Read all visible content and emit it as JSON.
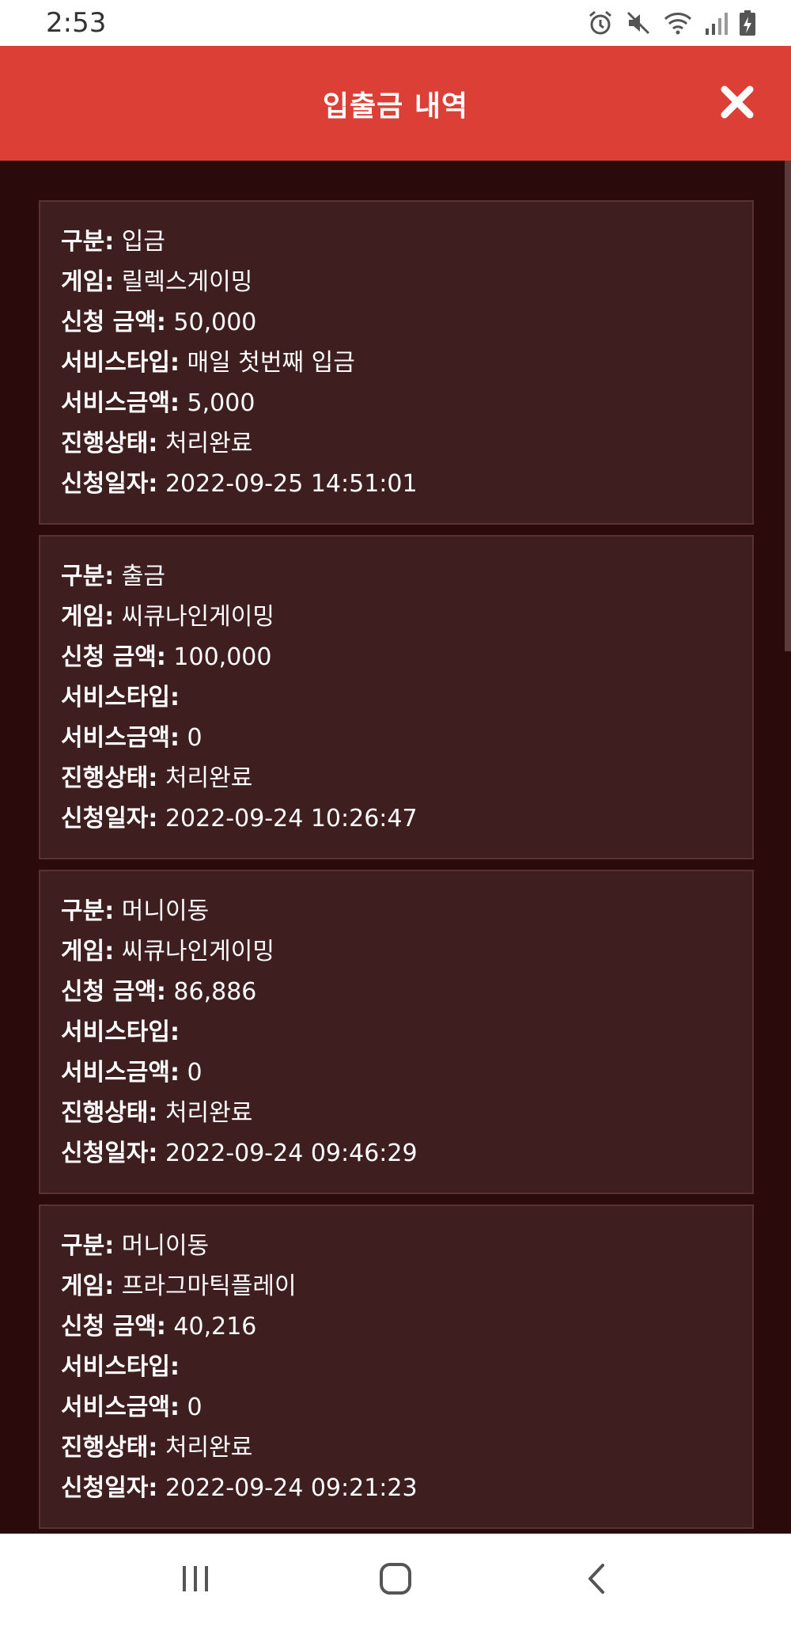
{
  "status_bar": {
    "time": "2:53",
    "icons": [
      "alarm-icon",
      "mute-icon",
      "wifi-icon",
      "signal-icon",
      "battery-charging-icon"
    ]
  },
  "header": {
    "title": "입출금 내역",
    "close_icon": "close-icon",
    "accent_color": "#dc3f36"
  },
  "labels": {
    "type": "구분",
    "game": "게임",
    "amount": "신청 금액",
    "service_type": "서비스타입",
    "service_amount": "서비스금액",
    "status": "진행상태",
    "date": "신청일자"
  },
  "records": [
    {
      "type": "입금",
      "game": "릴렉스게이밍",
      "amount": "50,000",
      "service_type": "매일 첫번째 입금",
      "service_amount": "5,000",
      "status": "처리완료",
      "date": "2022-09-25 14:51:01"
    },
    {
      "type": "출금",
      "game": "씨큐나인게이밍",
      "amount": "100,000",
      "service_type": "",
      "service_amount": "0",
      "status": "처리완료",
      "date": "2022-09-24 10:26:47"
    },
    {
      "type": "머니이동",
      "game": "씨큐나인게이밍",
      "amount": "86,886",
      "service_type": "",
      "service_amount": "0",
      "status": "처리완료",
      "date": "2022-09-24 09:46:29"
    },
    {
      "type": "머니이동",
      "game": "프라그마틱플레이",
      "amount": "40,216",
      "service_type": "",
      "service_amount": "0",
      "status": "처리완료",
      "date": "2022-09-24 09:21:23"
    }
  ],
  "nav_bar": {
    "icons": [
      "recent-apps-icon",
      "home-icon",
      "back-icon"
    ]
  }
}
